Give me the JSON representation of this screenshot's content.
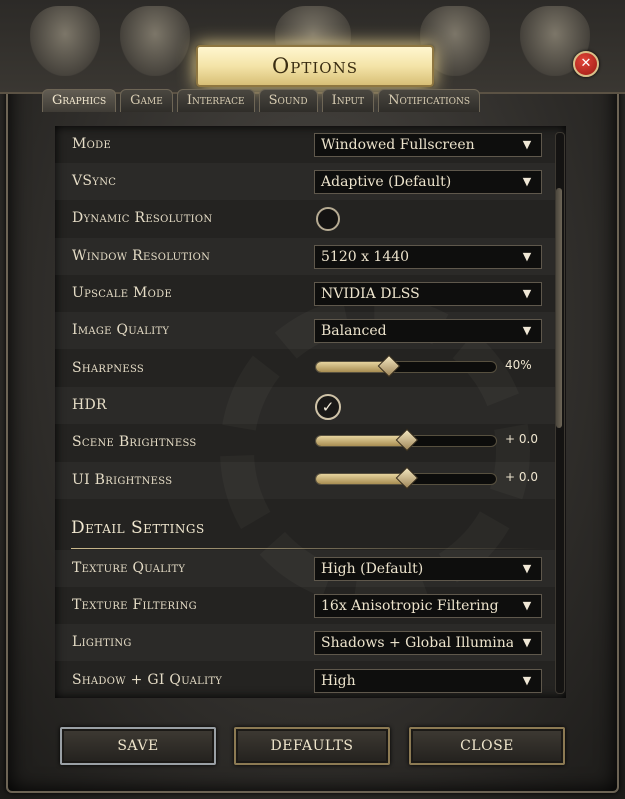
{
  "window": {
    "title": "Options"
  },
  "tabs": [
    {
      "label": "Graphics",
      "active": true
    },
    {
      "label": "Game"
    },
    {
      "label": "Interface"
    },
    {
      "label": "Sound"
    },
    {
      "label": "Input"
    },
    {
      "label": "Notifications"
    }
  ],
  "settings": {
    "mode": {
      "label": "Mode",
      "value": "Windowed Fullscreen"
    },
    "vsync": {
      "label": "VSync",
      "value": "Adaptive (Default)"
    },
    "dynamic_resolution": {
      "label": "Dynamic Resolution",
      "checked": false
    },
    "window_resolution": {
      "label": "Window Resolution",
      "value": "5120 x 1440"
    },
    "upscale_mode": {
      "label": "Upscale Mode",
      "value": "NVIDIA DLSS"
    },
    "image_quality": {
      "label": "Image Quality",
      "value": "Balanced"
    },
    "sharpness": {
      "label": "Sharpness",
      "value_text": "40%",
      "fraction": 0.4
    },
    "hdr": {
      "label": "HDR",
      "checked": true,
      "glyph": "✓"
    },
    "scene_brightness": {
      "label": "Scene Brightness",
      "value_text": "+ 0.0",
      "fraction": 0.5
    },
    "ui_brightness": {
      "label": "UI Brightness",
      "value_text": "+ 0.0",
      "fraction": 0.5
    }
  },
  "detail_settings": {
    "heading": "Detail Settings",
    "texture_quality": {
      "label": "Texture Quality",
      "value": "High (Default)"
    },
    "texture_filtering": {
      "label": "Texture Filtering",
      "value": "16x Anisotropic Filtering"
    },
    "lighting": {
      "label": "Lighting",
      "value": "Shadows + Global Illuminat"
    },
    "shadow_gi_quality": {
      "label": "Shadow + GI Quality",
      "value": "High"
    }
  },
  "buttons": {
    "save": "SAVE",
    "defaults": "DEFAULTS",
    "close": "CLOSE",
    "close_icon": "✕"
  },
  "icons": {
    "dropdown": "dropdown-arrow-icon",
    "close": "close-icon",
    "check": "checkmark-icon"
  }
}
